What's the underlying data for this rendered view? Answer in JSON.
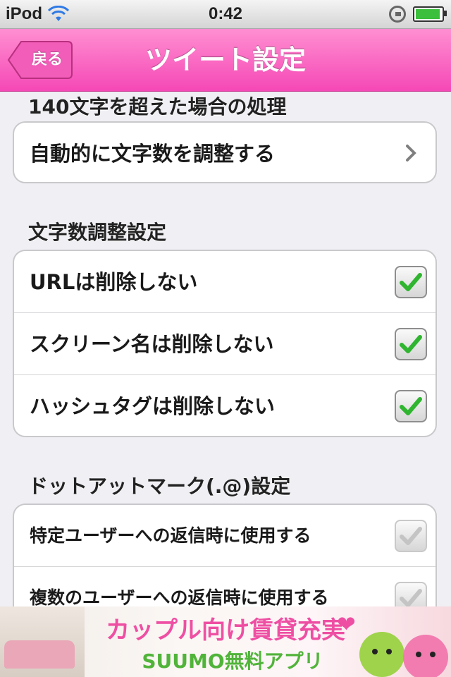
{
  "status_bar": {
    "carrier": "iPod",
    "time": "0:42"
  },
  "nav": {
    "back_label": "戻る",
    "title": "ツイート設定"
  },
  "sections": {
    "overflow": {
      "header": "140文字を超えた場合の処理",
      "row_label": "自動的に文字数を調整する"
    },
    "adjust": {
      "header": "文字数調整設定",
      "rows": [
        {
          "label": "URLは削除しない",
          "checked": true
        },
        {
          "label": "スクリーン名は削除しない",
          "checked": true
        },
        {
          "label": "ハッシュタグは削除しない",
          "checked": true
        }
      ]
    },
    "dotmark": {
      "header": "ドットアットマーク(.@)設定",
      "rows": [
        {
          "label": "特定ユーザーへの返信時に使用する",
          "checked": true,
          "enabled": false
        },
        {
          "label": "複数のユーザーへの返信時に使用する",
          "checked": true,
          "enabled": false
        }
      ]
    }
  },
  "ad": {
    "title": "カップル向け賃貸充実",
    "subtitle": "SUUMO無料アプリ"
  },
  "colors": {
    "nav_pink": "#f548b6",
    "check_green": "#2fb52f",
    "ad_pink": "#ee4fa3",
    "ad_green": "#51b43a"
  }
}
